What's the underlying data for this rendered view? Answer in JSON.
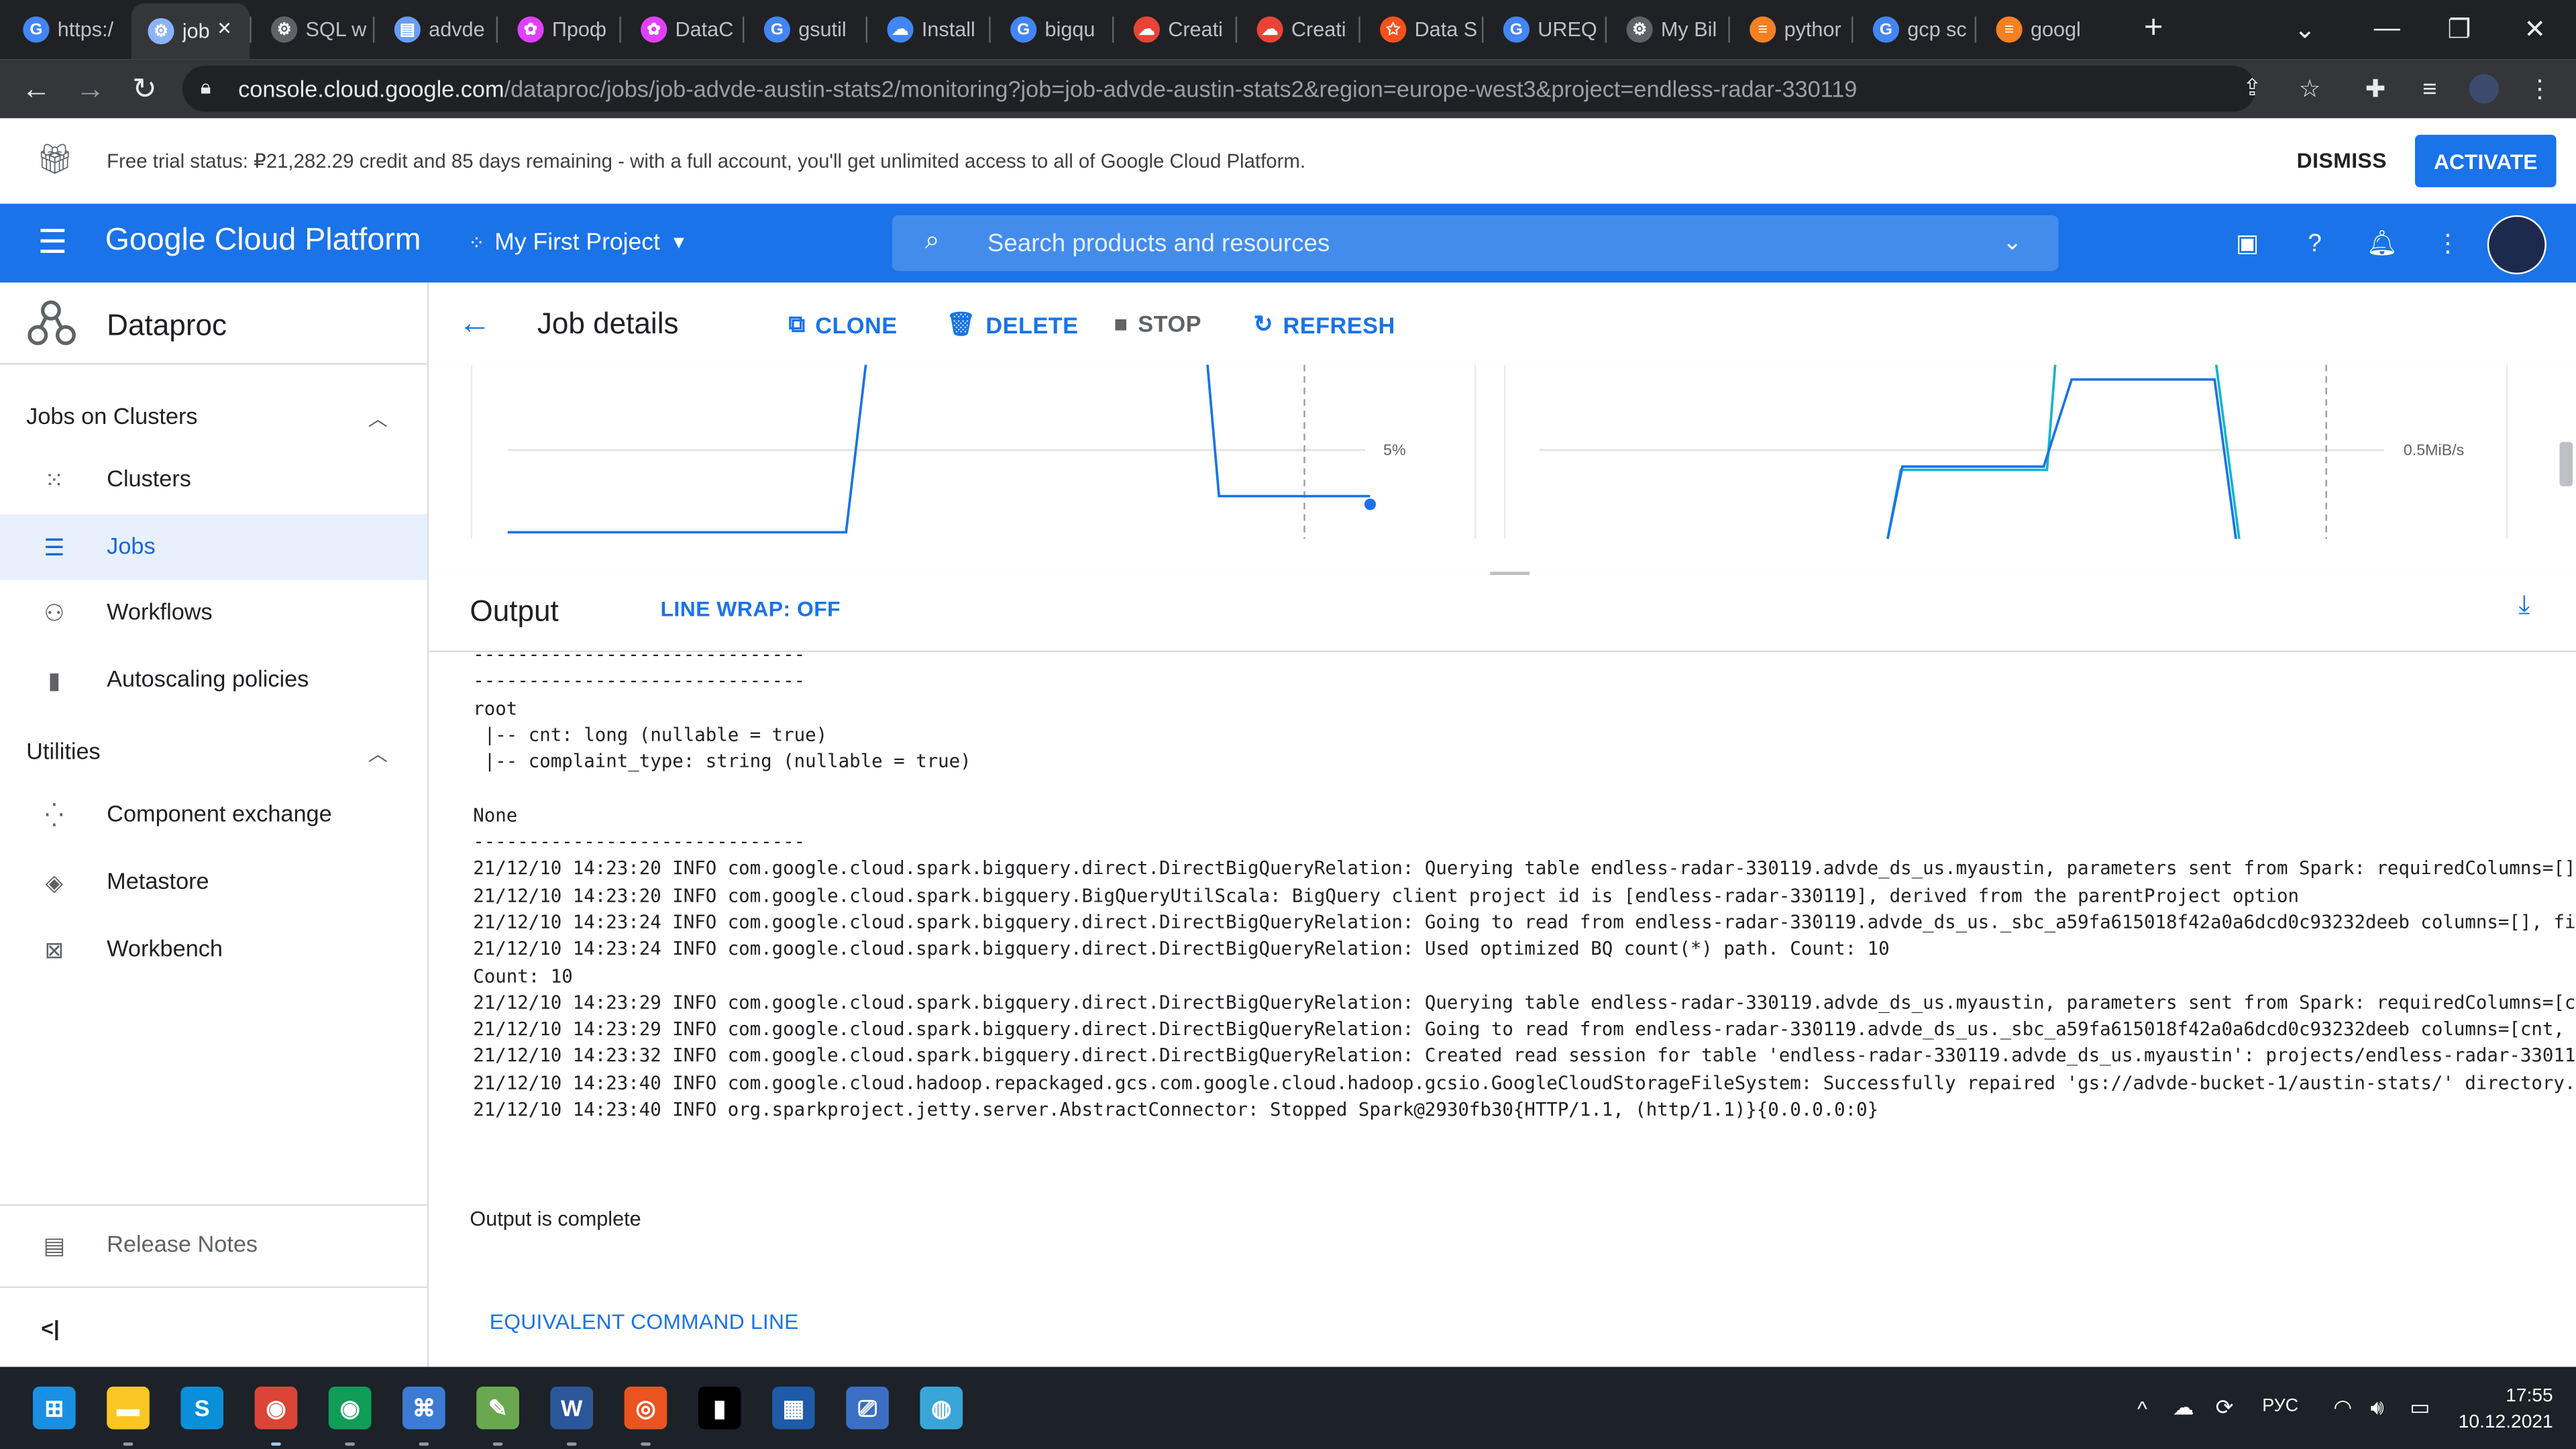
{
  "browser": {
    "tabs": [
      {
        "title": "https:/",
        "color": "#4285f4",
        "glyph": "G"
      },
      {
        "title": "job",
        "color": "#8ab4f8",
        "glyph": "⚙"
      },
      {
        "title": "SQL w",
        "color": "#5f6368",
        "glyph": "⚙"
      },
      {
        "title": "advde",
        "color": "#669df6",
        "glyph": "▤"
      },
      {
        "title": "Проф",
        "color": "#e040fb",
        "glyph": "✿"
      },
      {
        "title": "DataC",
        "color": "#e040fb",
        "glyph": "✿"
      },
      {
        "title": "gsutil",
        "color": "#4285f4",
        "glyph": "G"
      },
      {
        "title": "Install",
        "color": "#4285f4",
        "glyph": "☁"
      },
      {
        "title": "bigqu",
        "color": "#4285f4",
        "glyph": "G"
      },
      {
        "title": "Creati",
        "color": "#ea4335",
        "glyph": "☁"
      },
      {
        "title": "Creati",
        "color": "#ea4335",
        "glyph": "☁"
      },
      {
        "title": "Data S",
        "color": "#f4511e",
        "glyph": "✩"
      },
      {
        "title": "UREQ",
        "color": "#4285f4",
        "glyph": "G"
      },
      {
        "title": "My Bil",
        "color": "#5f6368",
        "glyph": "⚙"
      },
      {
        "title": "pythor",
        "color": "#f48024",
        "glyph": "≡"
      },
      {
        "title": "gcp sc",
        "color": "#4285f4",
        "glyph": "G"
      },
      {
        "title": "googl",
        "color": "#f48024",
        "glyph": "≡"
      }
    ],
    "active_tab_close": "✕",
    "new_tab": "+",
    "url_host": "console.cloud.google.com",
    "url_path": "/dataproc/jobs/job-advde-austin-stats2/monitoring?job=job-advde-austin-stats2&region=europe-west3&project=endless-radar-330119"
  },
  "trial_banner": {
    "text": "Free trial status: ₽21,282.29 credit and 85 days remaining - with a full account, you'll get unlimited access to all of Google Cloud Platform.",
    "dismiss_label": "DISMISS",
    "activate_label": "ACTIVATE"
  },
  "header": {
    "brand": "Google Cloud Platform",
    "project": "My First Project",
    "search_placeholder": "Search products and resources"
  },
  "sidebar": {
    "service_title": "Dataproc",
    "sections": [
      {
        "label": "Jobs on Clusters"
      },
      {
        "label": "Utilities"
      }
    ],
    "items": [
      {
        "label": "Clusters",
        "icon": "clusters-icon"
      },
      {
        "label": "Jobs",
        "icon": "jobs-icon",
        "selected": true
      },
      {
        "label": "Workflows",
        "icon": "workflows-icon"
      },
      {
        "label": "Autoscaling policies",
        "icon": "autoscaling-icon"
      },
      {
        "label": "Component exchange",
        "icon": "component-exchange-icon"
      },
      {
        "label": "Metastore",
        "icon": "metastore-icon"
      },
      {
        "label": "Workbench",
        "icon": "workbench-icon"
      }
    ],
    "release_notes": "Release Notes",
    "collapse_glyph": "<|"
  },
  "job": {
    "title": "Job details",
    "actions": {
      "clone": "CLONE",
      "delete": "DELETE",
      "stop": "STOP",
      "refresh": "REFRESH"
    }
  },
  "charts": {
    "left_tick": "5%",
    "right_tick": "0.5MiB/s"
  },
  "output": {
    "title": "Output",
    "line_wrap": "LINE WRAP: OFF",
    "log_lines": [
      "------------------------------",
      "------------------------------",
      "root",
      " |-- cnt: long (nullable = true)",
      " |-- complaint_type: string (nullable = true)",
      "",
      "None",
      "------------------------------",
      "21/12/10 14:23:20 INFO com.google.cloud.spark.bigquery.direct.DirectBigQueryRelation: Querying table endless-radar-330119.advde_ds_us.myaustin, parameters sent from Spark: requiredColumns=[]",
      "21/12/10 14:23:20 INFO com.google.cloud.spark.bigquery.BigQueryUtilScala: BigQuery client project id is [endless-radar-330119], derived from the parentProject option",
      "21/12/10 14:23:24 INFO com.google.cloud.spark.bigquery.direct.DirectBigQueryRelation: Going to read from endless-radar-330119.advde_ds_us._sbc_a59fa615018f42a0a6dcd0c93232deeb columns=[], fi",
      "21/12/10 14:23:24 INFO com.google.cloud.spark.bigquery.direct.DirectBigQueryRelation: Used optimized BQ count(*) path. Count: 10",
      "Count: 10",
      "21/12/10 14:23:29 INFO com.google.cloud.spark.bigquery.direct.DirectBigQueryRelation: Querying table endless-radar-330119.advde_ds_us.myaustin, parameters sent from Spark: requiredColumns=[c",
      "21/12/10 14:23:29 INFO com.google.cloud.spark.bigquery.direct.DirectBigQueryRelation: Going to read from endless-radar-330119.advde_ds_us._sbc_a59fa615018f42a0a6dcd0c93232deeb columns=[cnt,",
      "21/12/10 14:23:32 INFO com.google.cloud.spark.bigquery.direct.DirectBigQueryRelation: Created read session for table 'endless-radar-330119.advde_ds_us.myaustin': projects/endless-radar-33011",
      "21/12/10 14:23:40 INFO com.google.cloud.hadoop.repackaged.gcs.com.google.cloud.hadoop.gcsio.GoogleCloudStorageFileSystem: Successfully repaired 'gs://advde-bucket-1/austin-stats/' directory.",
      "21/12/10 14:23:40 INFO org.sparkproject.jetty.server.AbstractConnector: Stopped Spark@2930fb30{HTTP/1.1, (http/1.1)}{0.0.0.0:0}"
    ],
    "complete_text": "Output is complete",
    "equivalent_cmd": "EQUIVALENT COMMAND LINE"
  },
  "taskbar": {
    "apps": [
      {
        "name": "windows-start-icon",
        "glyph": "⊞",
        "color": "#1a8fe3"
      },
      {
        "name": "file-explorer-icon",
        "glyph": "▬",
        "color": "#f9c623"
      },
      {
        "name": "skype-icon",
        "glyph": "S",
        "color": "#0a8fd8"
      },
      {
        "name": "chrome-icon",
        "glyph": "◉",
        "color": "#db4437"
      },
      {
        "name": "chrome-profile-icon",
        "glyph": "◉",
        "color": "#0f9d58"
      },
      {
        "name": "network-app-icon",
        "glyph": "⌘",
        "color": "#3b7bd4"
      },
      {
        "name": "notepad-icon",
        "glyph": "✎",
        "color": "#6aa84f"
      },
      {
        "name": "word-icon",
        "glyph": "W",
        "color": "#2b579a"
      },
      {
        "name": "ubuntu-icon",
        "glyph": "◎",
        "color": "#e95420"
      },
      {
        "name": "terminal-icon",
        "glyph": "▮",
        "color": "#000000"
      },
      {
        "name": "calendar-app-icon",
        "glyph": "▦",
        "color": "#1e5aa8"
      },
      {
        "name": "remote-desktop-icon",
        "glyph": "⎚",
        "color": "#3a6fc4"
      },
      {
        "name": "globe-app-icon",
        "glyph": "◍",
        "color": "#3aa5d8"
      }
    ],
    "language": "РУС",
    "time": "17:55",
    "date": "10.12.2021"
  }
}
